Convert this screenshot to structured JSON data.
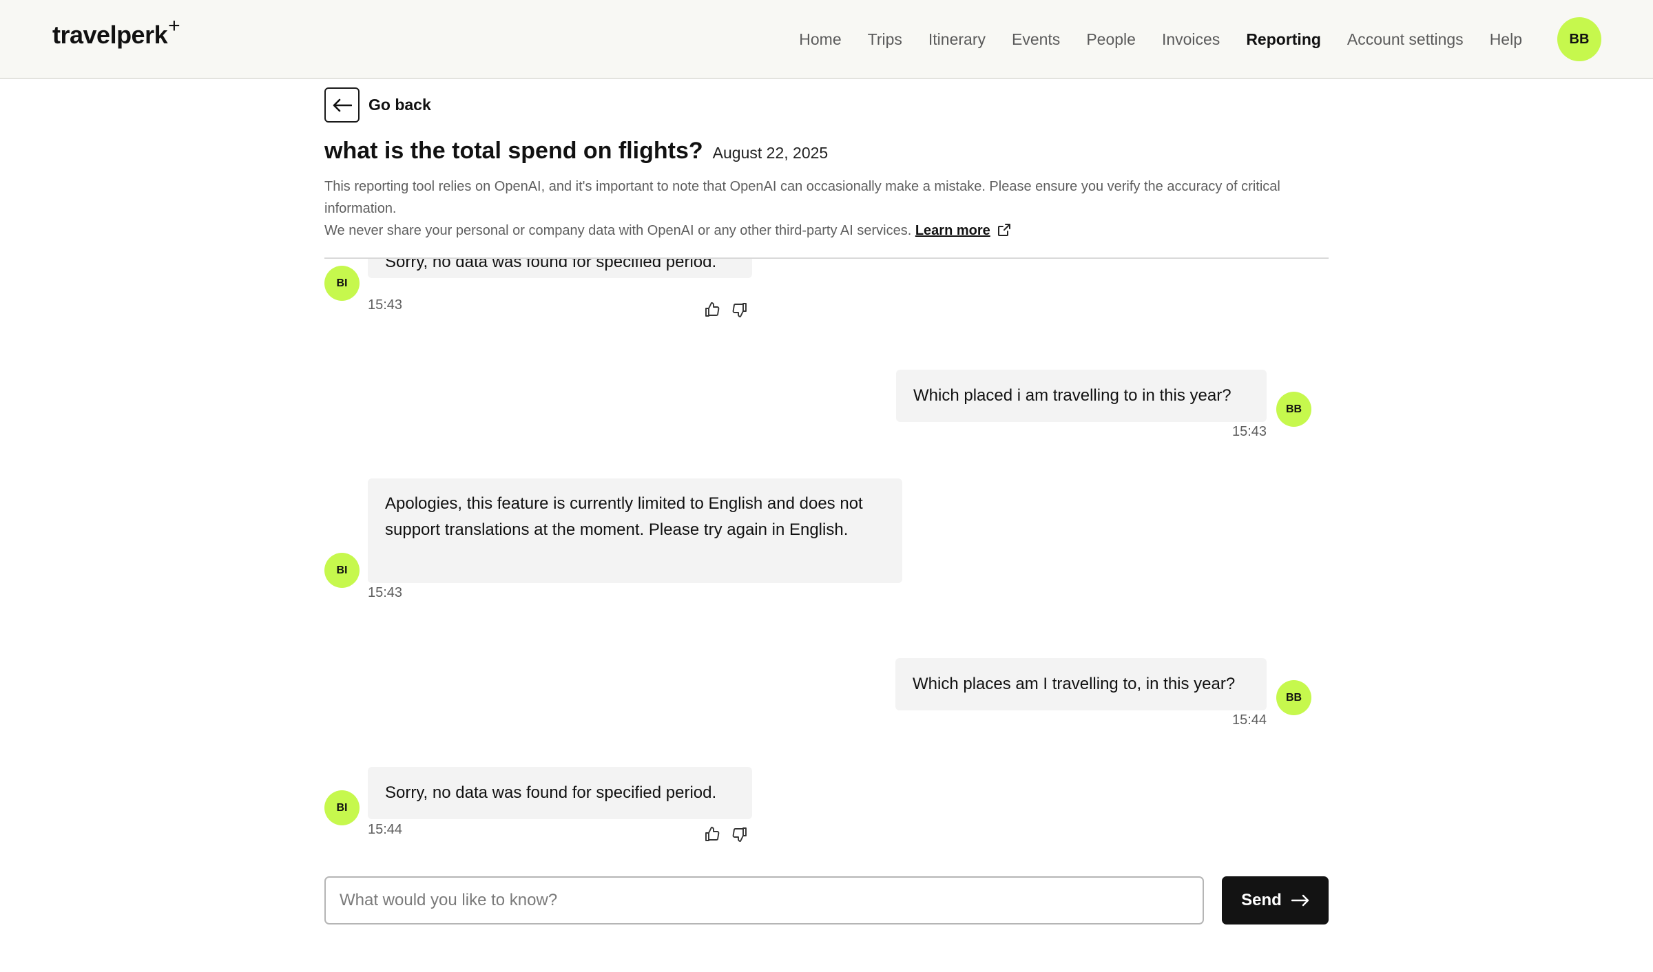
{
  "header": {
    "logo_text": "travelperk",
    "logo_plus": "+",
    "nav": [
      {
        "label": "Home"
      },
      {
        "label": "Trips"
      },
      {
        "label": "Itinerary"
      },
      {
        "label": "Events"
      },
      {
        "label": "People"
      },
      {
        "label": "Invoices"
      },
      {
        "label": "Reporting",
        "active": true
      },
      {
        "label": "Account settings"
      },
      {
        "label": "Help"
      }
    ],
    "user_initials": "BB"
  },
  "page": {
    "go_back": "Go back",
    "title": "what is the total spend on flights?",
    "date": "August 22, 2025",
    "disclaimer_line1": "This reporting tool relies on OpenAI, and it's important to note that OpenAI can occasionally make a mistake. Please ensure you verify the accuracy of critical information.",
    "disclaimer_line2": "We never share your personal or company data with OpenAI or any other third-party AI services.",
    "learn_more": "Learn more"
  },
  "chat": {
    "bot_initials": "BI",
    "user_initials": "BB",
    "messages": [
      {
        "from": "bot",
        "text": "Sorry, no data was found for specified period.",
        "time": "15:43"
      },
      {
        "from": "user",
        "text": "Which placed i am travelling to in this year?",
        "time": "15:43"
      },
      {
        "from": "bot",
        "text": "Apologies, this feature is currently limited to English and does not support translations at the moment. Please try again in English.",
        "time": "15:43"
      },
      {
        "from": "user",
        "text": "Which places am I travelling to, in this year?",
        "time": "15:44"
      },
      {
        "from": "bot",
        "text": "Sorry, no data was found for specified period.",
        "time": "15:44"
      }
    ]
  },
  "composer": {
    "placeholder": "What would you like to know?",
    "value": "",
    "send_label": "Send"
  },
  "colors": {
    "accent": "#c6f84d",
    "header_bg": "#f8f8f4",
    "bubble_bg": "#f3f3f3",
    "send_bg": "#131313"
  }
}
